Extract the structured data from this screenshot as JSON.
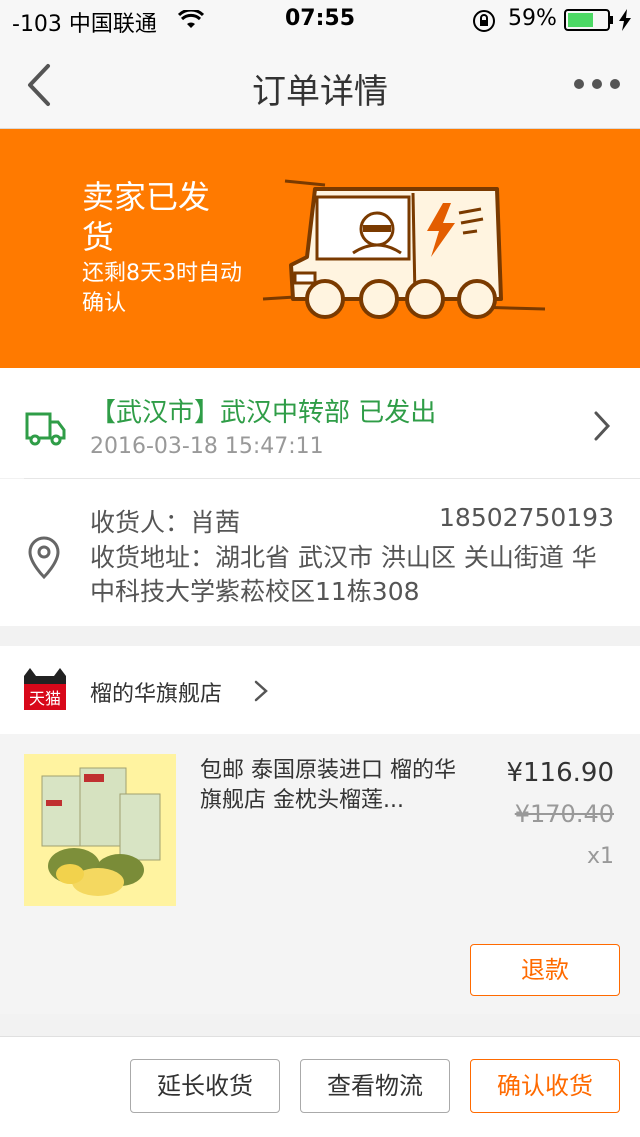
{
  "status_bar": {
    "carrier": "-103 中国联通",
    "time": "07:55",
    "battery": "59%",
    "icons": [
      "wifi-icon",
      "rotation-lock-icon",
      "battery-icon",
      "charging-icon"
    ]
  },
  "nav": {
    "title": "订单详情",
    "icons": [
      "back-arrow-icon",
      "more-icon"
    ]
  },
  "banner": {
    "status": "卖家已发货",
    "sub": "还剩8天3时自动确认",
    "background": "#ff7a00",
    "icon": "delivery-truck-illustration"
  },
  "logistics": {
    "text": "【武汉市】武汉中转部 已发出",
    "date": "2016-03-18 15:47:11",
    "accent": "#2f9d47",
    "icons": [
      "truck-icon",
      "chevron-right-icon"
    ]
  },
  "address": {
    "receiver": "收货人：肖茜",
    "phone": "18502750193",
    "addr": "收货地址：湖北省 武汉市 洪山区 关山街道 华中科技大学紫菘校区11栋308",
    "icon": "location-pin-icon"
  },
  "shop": {
    "logo_text": "天猫",
    "name": "榴的华旗舰店",
    "icons": [
      "tmall-logo-icon",
      "chevron-right-icon"
    ]
  },
  "product": {
    "title": "包邮 泰国原装进口 榴的华旗舰店 金枕头榴莲...",
    "price": "¥116.90",
    "original_price": "¥170.40",
    "qty": "x1",
    "refund_label": "退款"
  },
  "actions": {
    "extend": "延长收货",
    "logistics": "查看物流",
    "confirm": "确认收货",
    "accent": "#ff6a00"
  }
}
